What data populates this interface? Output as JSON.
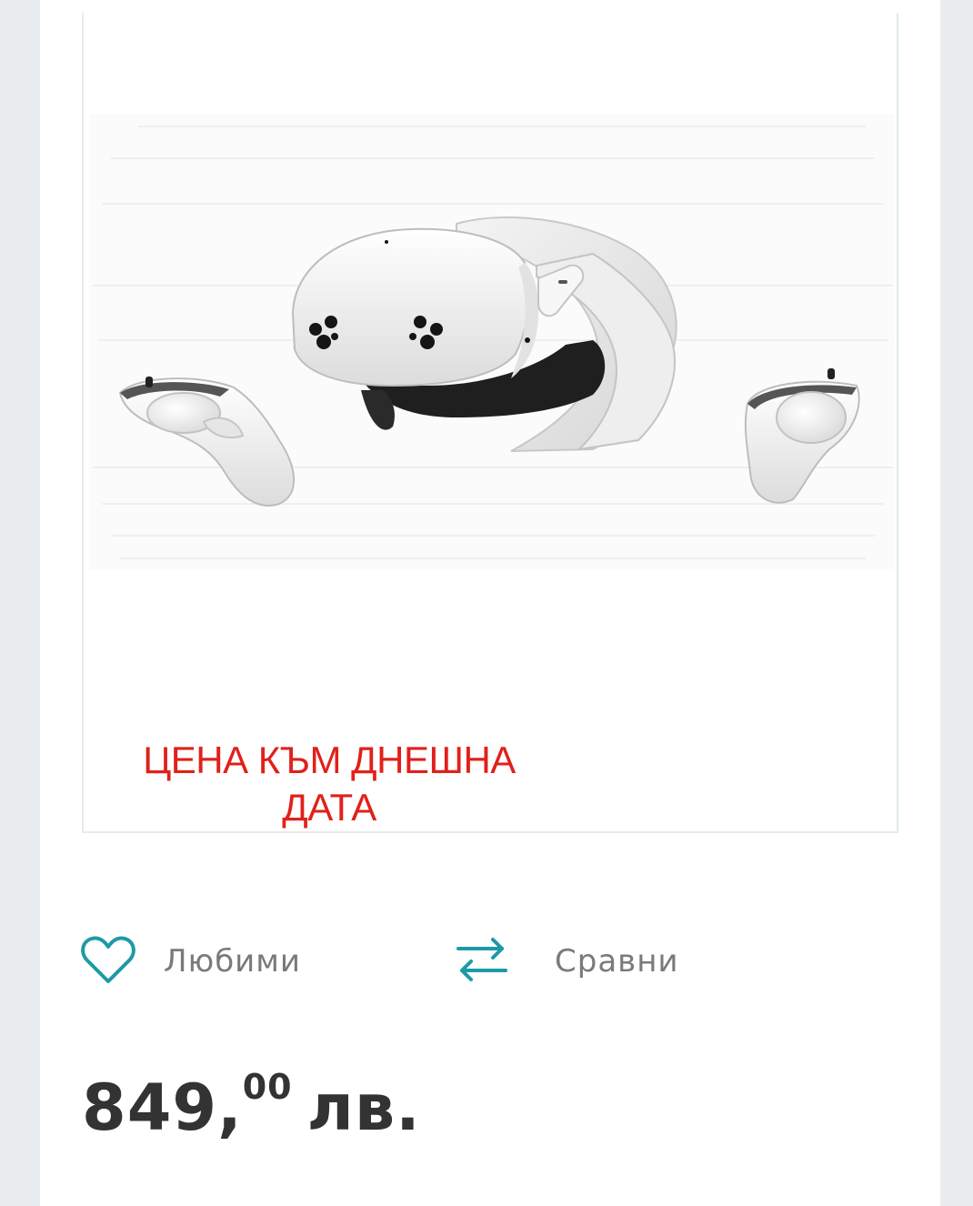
{
  "product": {
    "price_note": "ЦЕНА КЪМ ДНЕШНА ДАТА",
    "image_icon": "vr-headset-with-controllers"
  },
  "actions": {
    "wishlist": {
      "label": "Любими",
      "icon": "heart-icon"
    },
    "compare": {
      "label": "Сравни",
      "icon": "swap-arrows-icon"
    }
  },
  "price": {
    "whole": "849,",
    "cents": "00",
    "currency": "лв."
  },
  "colors": {
    "accent": "#1d9aa6",
    "note_red": "#e1201a",
    "price_text": "#333333",
    "label_text": "#7a7a7a",
    "background": "#e9edf0"
  }
}
